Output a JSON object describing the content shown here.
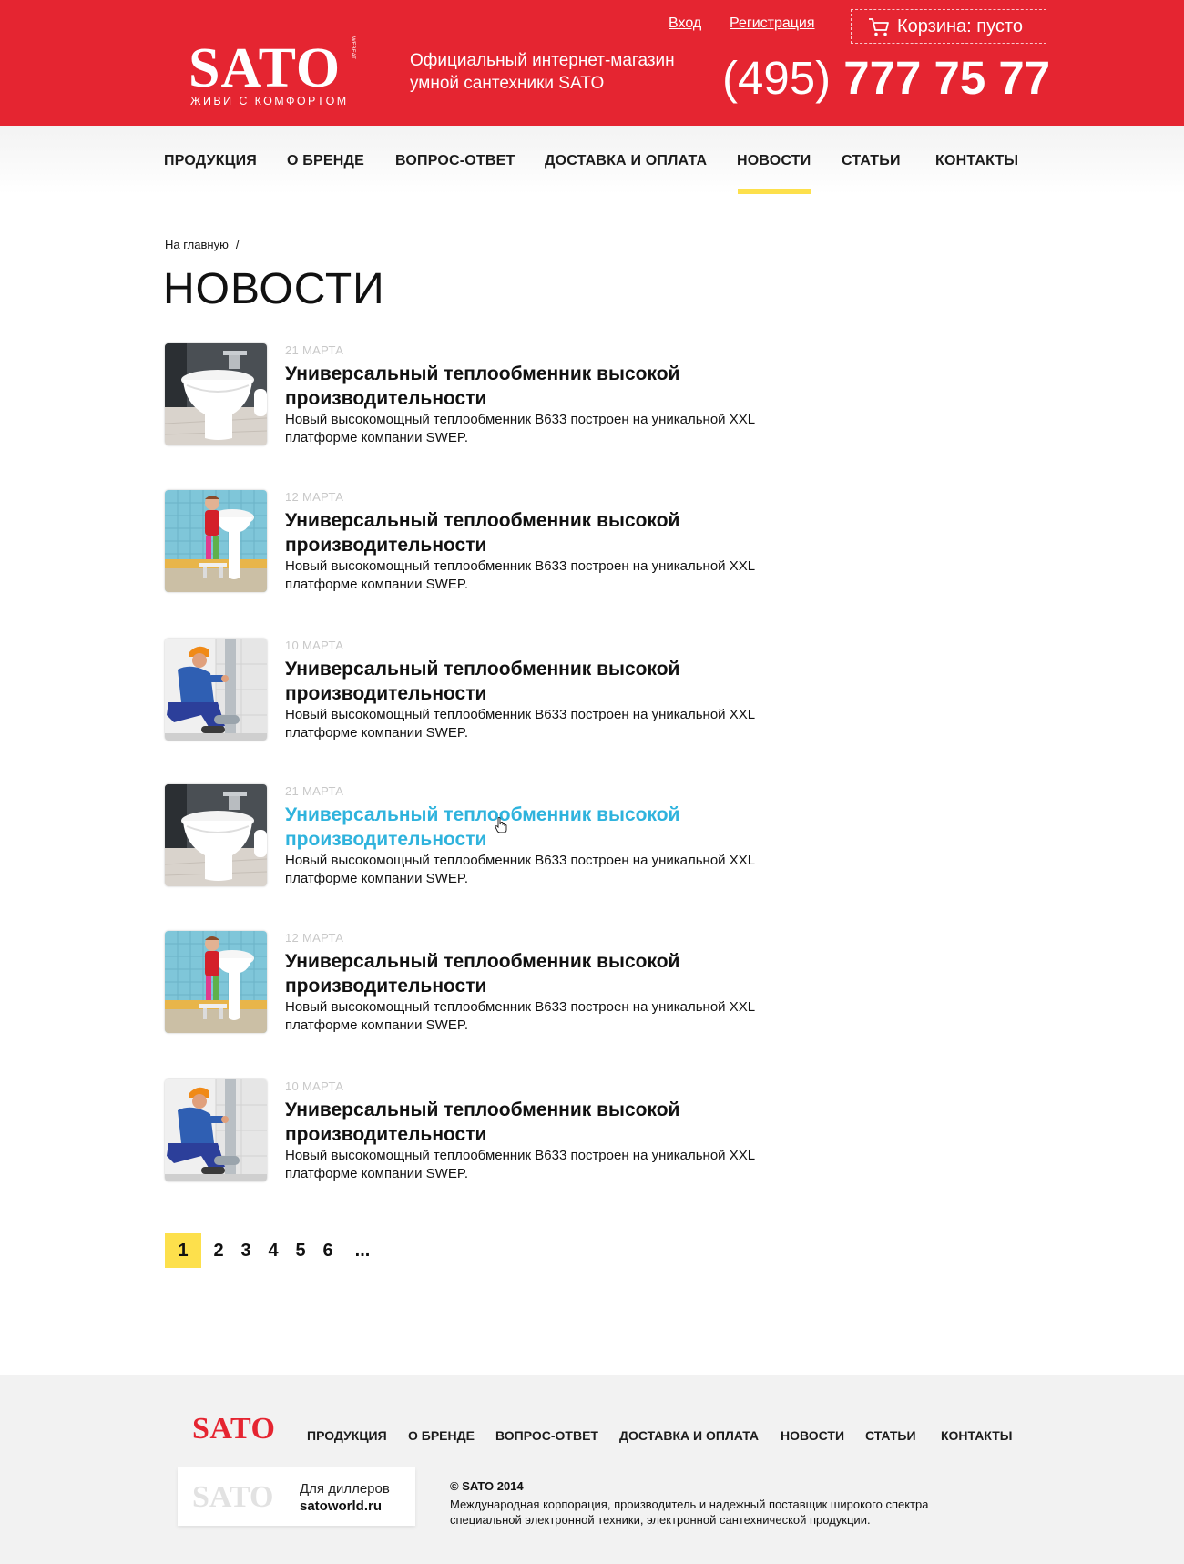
{
  "header": {
    "logo_text": "SATO",
    "logo_small": "WEBEAT",
    "tagline": "ЖИВИ С КОМФОРТОМ",
    "description_line1": "Официальный интернет-магазин",
    "description_line2": "умной сантехники SATO",
    "login": "Вход",
    "register": "Регистрация",
    "cart": "Корзина: пусто",
    "phone_code": "(495)",
    "phone_number": " 777 75 77",
    "cart_icon": "cart-icon",
    "accent_color": "#e52531"
  },
  "nav": {
    "items": [
      "ПРОДУКЦИЯ",
      "О БРЕНДЕ",
      "ВОПРОС-ОТВЕТ",
      "ДОСТАВКА И ОПЛАТА",
      "НОВОСТИ",
      "СТАТЬИ",
      "КОНТАКТЫ"
    ],
    "active": "НОВОСТИ",
    "active_color": "#fde04c"
  },
  "breadcrumb": {
    "home": "На главную",
    "separator": "/"
  },
  "page_title": "НОВОСТИ",
  "news": [
    {
      "date": "21 МАРТА",
      "title": "Универсальный теплообменник высокой производительности",
      "desc": "Новый высокомощный теплообменник B633 построен на уникальной XXL платформе компании SWEP.",
      "image": "bidet-photo"
    },
    {
      "date": "12 МАРТА",
      "title": "Универсальный теплообменник высокой производительности",
      "desc": "Новый высокомощный теплообменник B633 построен на уникальной XXL платформе компании SWEP.",
      "image": "child-sink-photo"
    },
    {
      "date": "10 МАРТА",
      "title": "Универсальный теплообменник высокой производительности",
      "desc": "Новый высокомощный теплообменник B633 построен на уникальной XXL платформе компании SWEP.",
      "image": "plumber-photo"
    },
    {
      "date": "21 МАРТА",
      "title": "Универсальный теплообменник высокой производительности",
      "desc": "Новый высокомощный теплообменник B633 построен на уникальной XXL платформе компании SWEP.",
      "image": "bidet-photo"
    },
    {
      "date": "12 МАРТА",
      "title": "Универсальный теплообменник высокой производительности",
      "desc": "Новый высокомощный теплообменник B633 построен на уникальной XXL платформе компании SWEP.",
      "image": "child-sink-photo"
    },
    {
      "date": "10 МАРТА",
      "title": "Универсальный теплообменник высокой производительности",
      "desc": "Новый высокомощный теплообменник B633 построен на уникальной XXL платформе компании SWEP.",
      "image": "plumber-photo"
    }
  ],
  "hover_color": "#2fb3dd",
  "pagination": {
    "pages": [
      "1",
      "2",
      "3",
      "4",
      "5",
      "6",
      "..."
    ],
    "current": "1"
  },
  "footer": {
    "logo_text": "SATO",
    "nav": [
      "ПРОДУКЦИЯ",
      "О БРЕНДЕ",
      "ВОПРОС-ОТВЕТ",
      "ДОСТАВКА И ОПЛАТА",
      "НОВОСТИ",
      "СТАТЬИ",
      "КОНТАКТЫ"
    ],
    "dealer_logo": "SATO",
    "dealer_label": "Для диллеров",
    "dealer_site": "satoworld.ru",
    "copyright": "©  SATO 2014",
    "company_line1": "Международная корпорация, производитель и надежный поставщик широкого спектра",
    "company_line2": "специальной электронной техники, электронной сантехнической продукции."
  }
}
